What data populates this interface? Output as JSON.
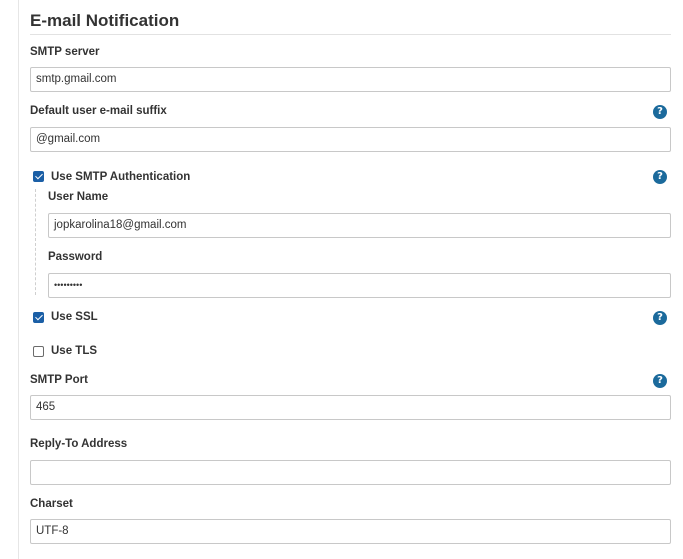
{
  "section": {
    "title": "E-mail Notification"
  },
  "smtp_server": {
    "label": "SMTP server",
    "value": "smtp.gmail.com"
  },
  "email_suffix": {
    "label": "Default user e-mail suffix",
    "value": "@gmail.com",
    "help": "?"
  },
  "smtp_auth": {
    "label": "Use SMTP Authentication",
    "checked": true,
    "help": "?",
    "username": {
      "label": "User Name",
      "value": "jopkarolina18@gmail.com"
    },
    "password": {
      "label": "Password",
      "value": "•••••••••"
    }
  },
  "use_ssl": {
    "label": "Use SSL",
    "checked": true,
    "help": "?"
  },
  "use_tls": {
    "label": "Use TLS",
    "checked": false
  },
  "smtp_port": {
    "label": "SMTP Port",
    "value": "465",
    "help": "?"
  },
  "reply_to": {
    "label": "Reply-To Address",
    "value": ""
  },
  "charset": {
    "label": "Charset",
    "value": "UTF-8"
  },
  "colors": {
    "help_icon": "#1b6a9c",
    "checkbox_checked": "#1b5fa6",
    "border": "#c8c8c8"
  }
}
